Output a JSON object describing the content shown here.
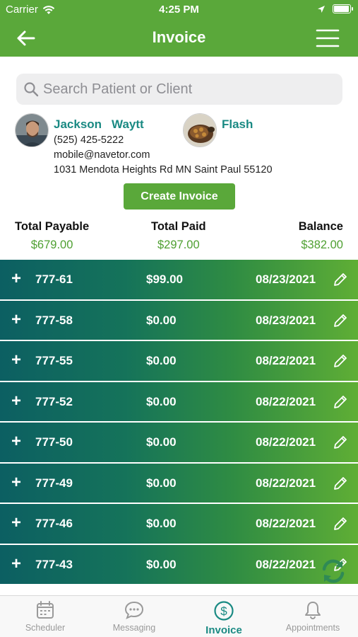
{
  "status_bar": {
    "carrier": "Carrier",
    "time": "4:25 PM",
    "battery_level": 0.95
  },
  "nav": {
    "title": "Invoice",
    "back_icon": "arrow-left-icon",
    "menu_icon": "hamburger-menu-icon"
  },
  "search": {
    "placeholder": "Search Patient or Client",
    "value": ""
  },
  "client": {
    "first_name": "Jackson",
    "last_name": "Waytt",
    "phone": "(525) 425-5222",
    "email": "mobile@navetor.com",
    "address": "1031 Mendota Heights Rd MN Saint Paul 55120"
  },
  "pet": {
    "name": "Flash"
  },
  "create_invoice_label": "Create Invoice",
  "totals": {
    "payable_label": "Total Payable",
    "payable": "$679.00",
    "paid_label": "Total Paid",
    "paid": "$297.00",
    "balance_label": "Balance",
    "balance": "$382.00"
  },
  "invoices": [
    {
      "number": "777-61",
      "amount": "$99.00",
      "date": "08/23/2021"
    },
    {
      "number": "777-58",
      "amount": "$0.00",
      "date": "08/23/2021"
    },
    {
      "number": "777-55",
      "amount": "$0.00",
      "date": "08/22/2021"
    },
    {
      "number": "777-52",
      "amount": "$0.00",
      "date": "08/22/2021"
    },
    {
      "number": "777-50",
      "amount": "$0.00",
      "date": "08/22/2021"
    },
    {
      "number": "777-49",
      "amount": "$0.00",
      "date": "08/22/2021"
    },
    {
      "number": "777-46",
      "amount": "$0.00",
      "date": "08/22/2021"
    },
    {
      "number": "777-43",
      "amount": "$0.00",
      "date": "08/22/2021"
    }
  ],
  "tabs": [
    {
      "label": "Scheduler",
      "icon": "calendar-icon",
      "active": false
    },
    {
      "label": "Messaging",
      "icon": "chat-bubble-icon",
      "active": false
    },
    {
      "label": "Invoice",
      "icon": "dollar-circle-icon",
      "active": true
    },
    {
      "label": "Appointments",
      "icon": "bell-icon",
      "active": false
    }
  ],
  "colors": {
    "brand_green": "#5aa83a",
    "accent_teal": "#1a8a83",
    "amount_green": "#4fa032",
    "row_gradient_start": "#0c5f62",
    "row_gradient_end": "#5fae35"
  }
}
